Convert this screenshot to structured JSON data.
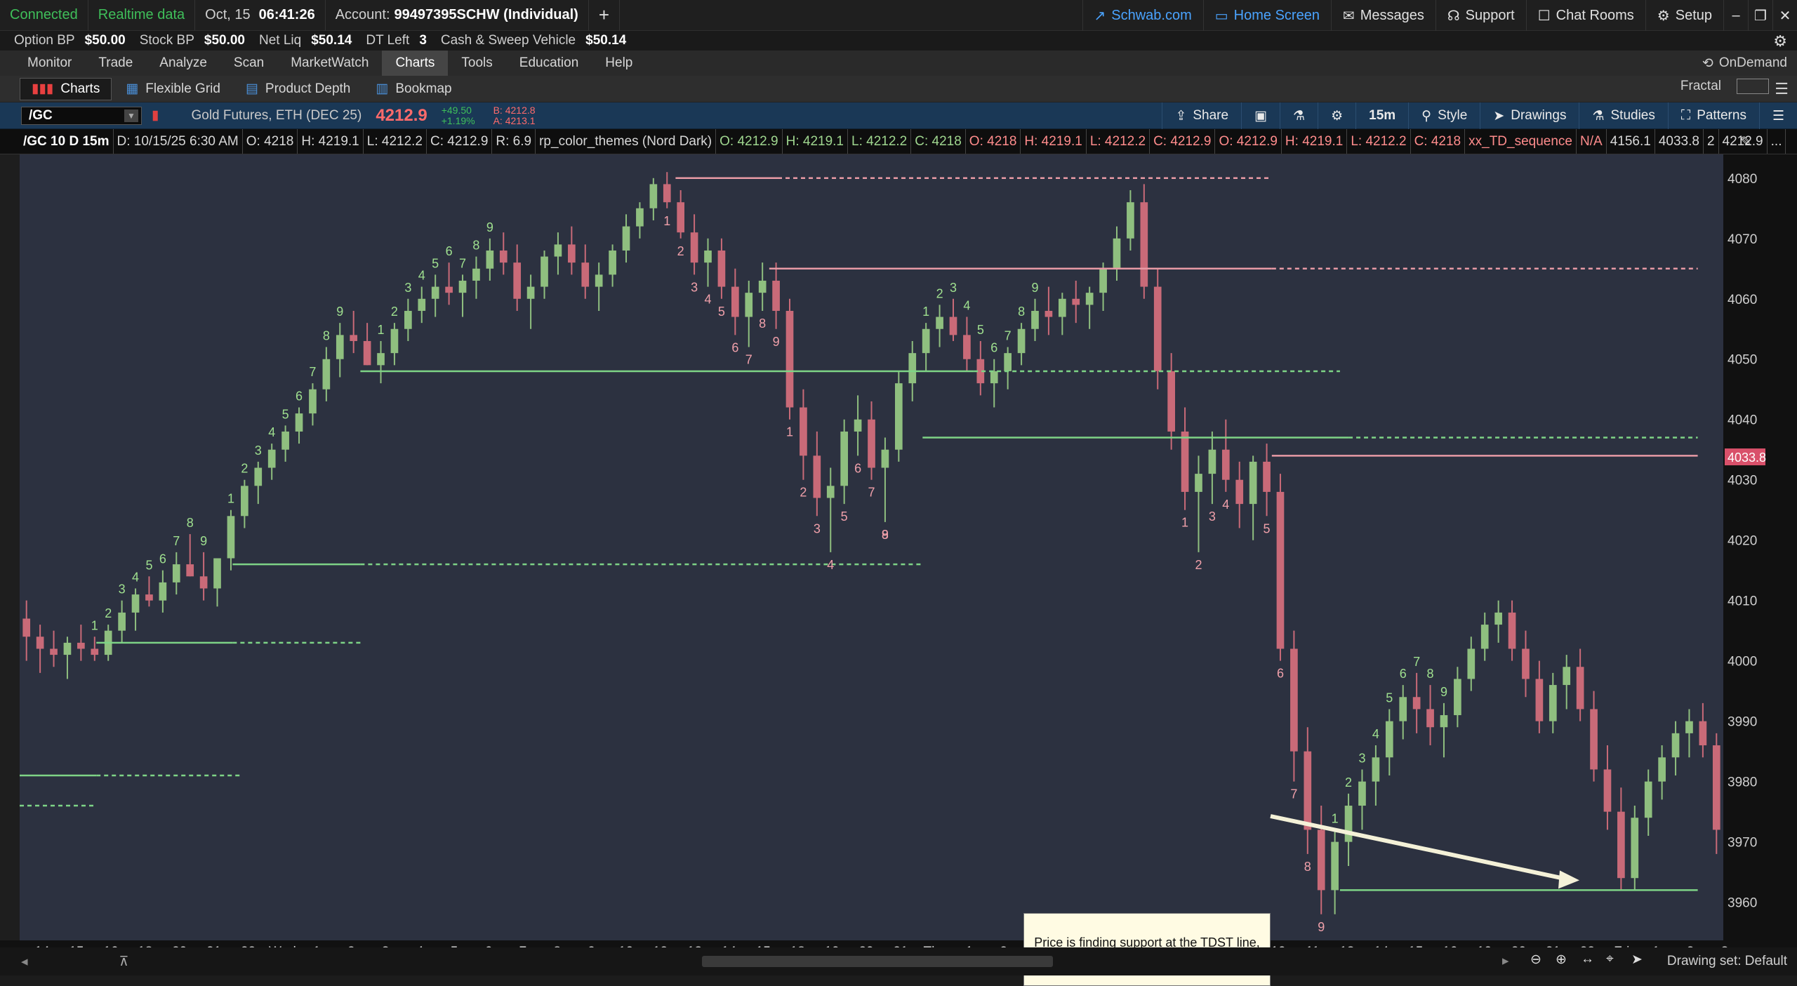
{
  "topbar": {
    "status": "Connected",
    "data_mode": "Realtime data",
    "date": "Oct, 15",
    "time": "06:41:26",
    "account_label": "Account:",
    "account_value": "99497395SCHW (Individual)",
    "links": [
      "Schwab.com",
      "Home Screen",
      "Messages",
      "Support",
      "Chat Rooms",
      "Setup"
    ]
  },
  "balances": [
    {
      "k": "Option BP",
      "v": "$50.00"
    },
    {
      "k": "Stock BP",
      "v": "$50.00"
    },
    {
      "k": "Net Liq",
      "v": "$50.14"
    },
    {
      "k": "DT Left",
      "v": "3"
    },
    {
      "k": "Cash & Sweep Vehicle",
      "v": "$50.14"
    }
  ],
  "menu": {
    "items": [
      "Monitor",
      "Trade",
      "Analyze",
      "Scan",
      "MarketWatch",
      "Charts",
      "Tools",
      "Education",
      "Help"
    ],
    "active": "Charts",
    "ondemand": "OnDemand"
  },
  "subtabs": {
    "items": [
      "Charts",
      "Flexible Grid",
      "Product Depth",
      "Bookmap"
    ],
    "fractal": "Fractal"
  },
  "symbol": {
    "ticker": "/GC",
    "description": "Gold Futures, ETH (DEC 25)",
    "last": "4212.9",
    "change": "+49.50",
    "change_pct": "+1.19%",
    "bid": "B: 4212.8",
    "ask": "A: 4213.1",
    "toolbar": [
      "Share",
      "15m",
      "Style",
      "Drawings",
      "Studies",
      "Patterns"
    ]
  },
  "study_line": [
    {
      "t": "/GC 10 D 15m",
      "c": "w"
    },
    {
      "t": "D: 10/15/25 6:30 AM",
      "c": "d"
    },
    {
      "t": "O: 4218",
      "c": "d"
    },
    {
      "t": "H: 4219.1",
      "c": "d"
    },
    {
      "t": "L: 4212.2",
      "c": "d"
    },
    {
      "t": "C: 4212.9",
      "c": "d"
    },
    {
      "t": "R: 6.9",
      "c": "d"
    },
    {
      "t": "rp_color_themes (Nord Dark)",
      "c": "d"
    },
    {
      "t": "O: 4212.9",
      "c": "g"
    },
    {
      "t": "H: 4219.1",
      "c": "g"
    },
    {
      "t": "L: 4212.2",
      "c": "g"
    },
    {
      "t": "C: 4218",
      "c": "g"
    },
    {
      "t": "O: 4218",
      "c": "r"
    },
    {
      "t": "H: 4219.1",
      "c": "r"
    },
    {
      "t": "L: 4212.2",
      "c": "r"
    },
    {
      "t": "C: 4212.9",
      "c": "r"
    },
    {
      "t": "O: 4212.9",
      "c": "r"
    },
    {
      "t": "H: 4219.1",
      "c": "r"
    },
    {
      "t": "L: 4212.2",
      "c": "r"
    },
    {
      "t": "C: 4218",
      "c": "r"
    },
    {
      "t": "xx_TD_sequence",
      "c": "r"
    },
    {
      "t": "N/A",
      "c": "r"
    },
    {
      "t": "4156.1",
      "c": "d"
    },
    {
      "t": "4033.8",
      "c": "d"
    },
    {
      "t": "2",
      "c": "d"
    },
    {
      "t": "4212.9",
      "c": "d"
    },
    {
      "t": "...",
      "c": "d"
    }
  ],
  "chart_data": {
    "type": "candlestick",
    "symbol": "/GC",
    "aggregation": "15m",
    "y_ticks": [
      4080,
      4070,
      4060,
      4050,
      4040,
      4030,
      4020,
      4010,
      4000,
      3990,
      3980,
      3970,
      3960
    ],
    "x_ticks": [
      "14",
      "15",
      "16",
      "18",
      "20",
      "21",
      "22",
      "Wed",
      "1",
      "2",
      "3",
      "4",
      "5",
      "6",
      "7",
      "8",
      "9",
      "10",
      "12",
      "13",
      "14",
      "15",
      "18",
      "19",
      "20",
      "21",
      "Thu",
      "1",
      "2",
      "3",
      "4",
      "5",
      "6",
      "7",
      "8",
      "9",
      "10",
      "11",
      "13",
      "14",
      "15",
      "16",
      "19",
      "20",
      "21",
      "22",
      "Fri",
      "1",
      "2",
      "3"
    ],
    "price_marker": "4033.8",
    "ylim": [
      3956,
      4083
    ],
    "colors": {
      "up": "#8fbf7f",
      "down": "#c96a78",
      "bg": "#2c3140",
      "support": "#7ed486",
      "resistance": "#e89aa5"
    },
    "candles_ohlc": [
      [
        4007,
        4010,
        4000,
        4004
      ],
      [
        4004,
        4006,
        3998,
        4002
      ],
      [
        4002,
        4005,
        3999,
        4001
      ],
      [
        4001,
        4004,
        3997,
        4003
      ],
      [
        4003,
        4006,
        4000,
        4002
      ],
      [
        4002,
        4004,
        4000,
        4001
      ],
      [
        4001,
        4006,
        4000,
        4005
      ],
      [
        4005,
        4010,
        4003,
        4008
      ],
      [
        4008,
        4012,
        4005,
        4011
      ],
      [
        4011,
        4014,
        4009,
        4010
      ],
      [
        4010,
        4015,
        4008,
        4013
      ],
      [
        4013,
        4018,
        4011,
        4016
      ],
      [
        4016,
        4021,
        4014,
        4014
      ],
      [
        4014,
        4018,
        4010,
        4012
      ],
      [
        4012,
        4016,
        4009,
        4017
      ],
      [
        4017,
        4025,
        4015,
        4024
      ],
      [
        4024,
        4030,
        4022,
        4029
      ],
      [
        4029,
        4033,
        4026,
        4032
      ],
      [
        4032,
        4036,
        4030,
        4035
      ],
      [
        4035,
        4039,
        4033,
        4038
      ],
      [
        4038,
        4042,
        4036,
        4041
      ],
      [
        4041,
        4046,
        4039,
        4045
      ],
      [
        4045,
        4052,
        4043,
        4050
      ],
      [
        4050,
        4056,
        4047,
        4054
      ],
      [
        4054,
        4058,
        4051,
        4053
      ],
      [
        4053,
        4056,
        4049,
        4049
      ],
      [
        4049,
        4053,
        4046,
        4051
      ],
      [
        4051,
        4056,
        4049,
        4055
      ],
      [
        4055,
        4060,
        4053,
        4058
      ],
      [
        4058,
        4062,
        4056,
        4060
      ],
      [
        4060,
        4064,
        4057,
        4062
      ],
      [
        4062,
        4066,
        4059,
        4061
      ],
      [
        4061,
        4064,
        4057,
        4063
      ],
      [
        4063,
        4067,
        4060,
        4065
      ],
      [
        4065,
        4070,
        4063,
        4068
      ],
      [
        4068,
        4071,
        4064,
        4066
      ],
      [
        4066,
        4069,
        4058,
        4060
      ],
      [
        4060,
        4064,
        4055,
        4062
      ],
      [
        4062,
        4068,
        4060,
        4067
      ],
      [
        4067,
        4071,
        4064,
        4069
      ],
      [
        4069,
        4072,
        4064,
        4066
      ],
      [
        4066,
        4069,
        4060,
        4062
      ],
      [
        4062,
        4066,
        4058,
        4064
      ],
      [
        4064,
        4069,
        4062,
        4068
      ],
      [
        4068,
        4074,
        4066,
        4072
      ],
      [
        4072,
        4076,
        4070,
        4075
      ],
      [
        4075,
        4080,
        4073,
        4079
      ],
      [
        4079,
        4081,
        4075,
        4076
      ],
      [
        4076,
        4078,
        4070,
        4071
      ],
      [
        4071,
        4074,
        4064,
        4066
      ],
      [
        4066,
        4070,
        4062,
        4068
      ],
      [
        4068,
        4070,
        4060,
        4062
      ],
      [
        4062,
        4065,
        4054,
        4057
      ],
      [
        4057,
        4063,
        4052,
        4061
      ],
      [
        4061,
        4066,
        4058,
        4063
      ],
      [
        4063,
        4066,
        4055,
        4058
      ],
      [
        4058,
        4060,
        4040,
        4042
      ],
      [
        4042,
        4045,
        4030,
        4034
      ],
      [
        4034,
        4038,
        4024,
        4027
      ],
      [
        4027,
        4032,
        4018,
        4029
      ],
      [
        4029,
        4040,
        4026,
        4038
      ],
      [
        4038,
        4044,
        4034,
        4040
      ],
      [
        4040,
        4043,
        4030,
        4032
      ],
      [
        4032,
        4037,
        4023,
        4035
      ],
      [
        4035,
        4048,
        4033,
        4046
      ],
      [
        4046,
        4053,
        4043,
        4051
      ],
      [
        4051,
        4056,
        4048,
        4055
      ],
      [
        4055,
        4059,
        4052,
        4057
      ],
      [
        4057,
        4060,
        4053,
        4054
      ],
      [
        4054,
        4057,
        4048,
        4050
      ],
      [
        4050,
        4053,
        4044,
        4046
      ],
      [
        4046,
        4050,
        4042,
        4048
      ],
      [
        4048,
        4052,
        4045,
        4051
      ],
      [
        4051,
        4056,
        4049,
        4055
      ],
      [
        4055,
        4060,
        4053,
        4058
      ],
      [
        4058,
        4062,
        4054,
        4057
      ],
      [
        4057,
        4061,
        4054,
        4060
      ],
      [
        4060,
        4063,
        4056,
        4059
      ],
      [
        4059,
        4062,
        4055,
        4061
      ],
      [
        4061,
        4066,
        4058,
        4065
      ],
      [
        4065,
        4072,
        4063,
        4070
      ],
      [
        4070,
        4078,
        4068,
        4076
      ],
      [
        4076,
        4079,
        4060,
        4062
      ],
      [
        4062,
        4065,
        4045,
        4048
      ],
      [
        4048,
        4051,
        4035,
        4038
      ],
      [
        4038,
        4042,
        4025,
        4028
      ],
      [
        4028,
        4034,
        4018,
        4031
      ],
      [
        4031,
        4038,
        4026,
        4035
      ],
      [
        4035,
        4040,
        4028,
        4030
      ],
      [
        4030,
        4033,
        4022,
        4026
      ],
      [
        4026,
        4034,
        4020,
        4033
      ],
      [
        4033,
        4036,
        4024,
        4028
      ],
      [
        4028,
        4031,
        4000,
        4002
      ],
      [
        4002,
        4005,
        3980,
        3985
      ],
      [
        3985,
        3989,
        3968,
        3972
      ],
      [
        3972,
        3976,
        3958,
        3962
      ],
      [
        3962,
        3972,
        3958,
        3970
      ],
      [
        3970,
        3978,
        3966,
        3976
      ],
      [
        3976,
        3982,
        3972,
        3980
      ],
      [
        3980,
        3986,
        3976,
        3984
      ],
      [
        3984,
        3992,
        3981,
        3990
      ],
      [
        3990,
        3996,
        3987,
        3994
      ],
      [
        3994,
        3998,
        3988,
        3992
      ],
      [
        3992,
        3996,
        3986,
        3989
      ],
      [
        3989,
        3993,
        3984,
        3991
      ],
      [
        3991,
        3999,
        3989,
        3997
      ],
      [
        3997,
        4004,
        3995,
        4002
      ],
      [
        4002,
        4008,
        4000,
        4006
      ],
      [
        4006,
        4010,
        4003,
        4008
      ],
      [
        4008,
        4010,
        4000,
        4002
      ],
      [
        4002,
        4005,
        3994,
        3997
      ],
      [
        3997,
        4000,
        3988,
        3990
      ],
      [
        3990,
        3998,
        3988,
        3996
      ],
      [
        3996,
        4001,
        3992,
        3999
      ],
      [
        3999,
        4002,
        3990,
        3992
      ],
      [
        3992,
        3995,
        3980,
        3982
      ],
      [
        3982,
        3986,
        3972,
        3975
      ],
      [
        3975,
        3979,
        3962,
        3964
      ],
      [
        3964,
        3976,
        3962,
        3974
      ],
      [
        3974,
        3982,
        3971,
        3980
      ],
      [
        3980,
        3986,
        3977,
        3984
      ],
      [
        3984,
        3990,
        3981,
        3988
      ],
      [
        3988,
        3992,
        3984,
        3990
      ],
      [
        3990,
        3993,
        3984,
        3986
      ],
      [
        3986,
        3988,
        3968,
        3972
      ]
    ],
    "levels": [
      {
        "price": 4080,
        "color": "resistance",
        "from": 0.385,
        "solid_to": 0.445,
        "to": 0.735
      },
      {
        "price": 4065,
        "color": "resistance",
        "from": 0.44,
        "solid_to": 0.735,
        "to": 0.985
      },
      {
        "price": 4048,
        "color": "support",
        "from": 0.2,
        "solid_to": 0.56,
        "to": 0.775
      },
      {
        "price": 4037,
        "color": "support",
        "from": 0.53,
        "solid_to": 0.78,
        "to": 0.985
      },
      {
        "price": 4034,
        "color": "resistance",
        "from": 0.735,
        "solid_to": 0.985,
        "to": 0.985
      },
      {
        "price": 4016,
        "color": "support",
        "from": 0.125,
        "solid_to": 0.2,
        "to": 0.53
      },
      {
        "price": 4003,
        "color": "support",
        "from": 0.045,
        "solid_to": 0.125,
        "to": 0.2
      },
      {
        "price": 3981,
        "color": "support",
        "from": 0.0,
        "solid_to": 0.045,
        "to": 0.13
      },
      {
        "price": 3976,
        "color": "support",
        "from": 0.0,
        "solid_to": 0.0,
        "to": 0.045
      },
      {
        "price": 3962,
        "color": "support",
        "from": 0.775,
        "solid_to": 0.985,
        "to": 0.985
      }
    ],
    "td_counts": [
      {
        "i": 5,
        "n": "1",
        "c": "g"
      },
      {
        "i": 6,
        "n": "2",
        "c": "g"
      },
      {
        "i": 7,
        "n": "3",
        "c": "g"
      },
      {
        "i": 8,
        "n": "4",
        "c": "g"
      },
      {
        "i": 9,
        "n": "5",
        "c": "g"
      },
      {
        "i": 10,
        "n": "6",
        "c": "g"
      },
      {
        "i": 11,
        "n": "7",
        "c": "g"
      },
      {
        "i": 12,
        "n": "8",
        "c": "g"
      },
      {
        "i": 13,
        "n": "9",
        "c": "g"
      },
      {
        "i": 15,
        "n": "1",
        "c": "g"
      },
      {
        "i": 16,
        "n": "2",
        "c": "g"
      },
      {
        "i": 17,
        "n": "3",
        "c": "g"
      },
      {
        "i": 18,
        "n": "4",
        "c": "g"
      },
      {
        "i": 19,
        "n": "5",
        "c": "g"
      },
      {
        "i": 20,
        "n": "6",
        "c": "g"
      },
      {
        "i": 21,
        "n": "7",
        "c": "g"
      },
      {
        "i": 22,
        "n": "8",
        "c": "g"
      },
      {
        "i": 23,
        "n": "9",
        "c": "g"
      },
      {
        "i": 26,
        "n": "1",
        "c": "g"
      },
      {
        "i": 27,
        "n": "2",
        "c": "g"
      },
      {
        "i": 28,
        "n": "3",
        "c": "g"
      },
      {
        "i": 29,
        "n": "4",
        "c": "g"
      },
      {
        "i": 30,
        "n": "5",
        "c": "g"
      },
      {
        "i": 31,
        "n": "6",
        "c": "g"
      },
      {
        "i": 32,
        "n": "7",
        "c": "g"
      },
      {
        "i": 33,
        "n": "8",
        "c": "g"
      },
      {
        "i": 34,
        "n": "9",
        "c": "g"
      },
      {
        "i": 47,
        "n": "1",
        "c": "r"
      },
      {
        "i": 48,
        "n": "2",
        "c": "r"
      },
      {
        "i": 49,
        "n": "3",
        "c": "r"
      },
      {
        "i": 50,
        "n": "4",
        "c": "r"
      },
      {
        "i": 51,
        "n": "5",
        "c": "r"
      },
      {
        "i": 52,
        "n": "6",
        "c": "r"
      },
      {
        "i": 53,
        "n": "7",
        "c": "r"
      },
      {
        "i": 54,
        "n": "8",
        "c": "r"
      },
      {
        "i": 55,
        "n": "9",
        "c": "r"
      },
      {
        "i": 56,
        "n": "1",
        "c": "r"
      },
      {
        "i": 57,
        "n": "2",
        "c": "r"
      },
      {
        "i": 58,
        "n": "3",
        "c": "r"
      },
      {
        "i": 59,
        "n": "4",
        "c": "r"
      },
      {
        "i": 60,
        "n": "5",
        "c": "r"
      },
      {
        "i": 61,
        "n": "6",
        "c": "r"
      },
      {
        "i": 62,
        "n": "7",
        "c": "r"
      },
      {
        "i": 63,
        "n": "8",
        "c": "r"
      },
      {
        "i": 63,
        "n": "9",
        "c": "r"
      },
      {
        "i": 66,
        "n": "1",
        "c": "g"
      },
      {
        "i": 67,
        "n": "2",
        "c": "g"
      },
      {
        "i": 68,
        "n": "3",
        "c": "g"
      },
      {
        "i": 69,
        "n": "4",
        "c": "g"
      },
      {
        "i": 70,
        "n": "5",
        "c": "g"
      },
      {
        "i": 71,
        "n": "6",
        "c": "g"
      },
      {
        "i": 72,
        "n": "7",
        "c": "g"
      },
      {
        "i": 73,
        "n": "8",
        "c": "g"
      },
      {
        "i": 74,
        "n": "9",
        "c": "g"
      },
      {
        "i": 85,
        "n": "1",
        "c": "r"
      },
      {
        "i": 86,
        "n": "2",
        "c": "r"
      },
      {
        "i": 87,
        "n": "3",
        "c": "r"
      },
      {
        "i": 88,
        "n": "4",
        "c": "r"
      },
      {
        "i": 91,
        "n": "5",
        "c": "r"
      },
      {
        "i": 92,
        "n": "6",
        "c": "r"
      },
      {
        "i": 93,
        "n": "7",
        "c": "r"
      },
      {
        "i": 94,
        "n": "8",
        "c": "r"
      },
      {
        "i": 95,
        "n": "9",
        "c": "r"
      },
      {
        "i": 96,
        "n": "1",
        "c": "g"
      },
      {
        "i": 97,
        "n": "2",
        "c": "g"
      },
      {
        "i": 98,
        "n": "3",
        "c": "g"
      },
      {
        "i": 99,
        "n": "4",
        "c": "g"
      },
      {
        "i": 100,
        "n": "5",
        "c": "g"
      },
      {
        "i": 101,
        "n": "6",
        "c": "g"
      },
      {
        "i": 102,
        "n": "7",
        "c": "g"
      },
      {
        "i": 103,
        "n": "8",
        "c": "g"
      },
      {
        "i": 104,
        "n": "9",
        "c": "g"
      }
    ],
    "annotation": "Price is finding support at the TDST line, not the swing low."
  },
  "statusbar": {
    "drawing_set": "Drawing set: Default"
  }
}
